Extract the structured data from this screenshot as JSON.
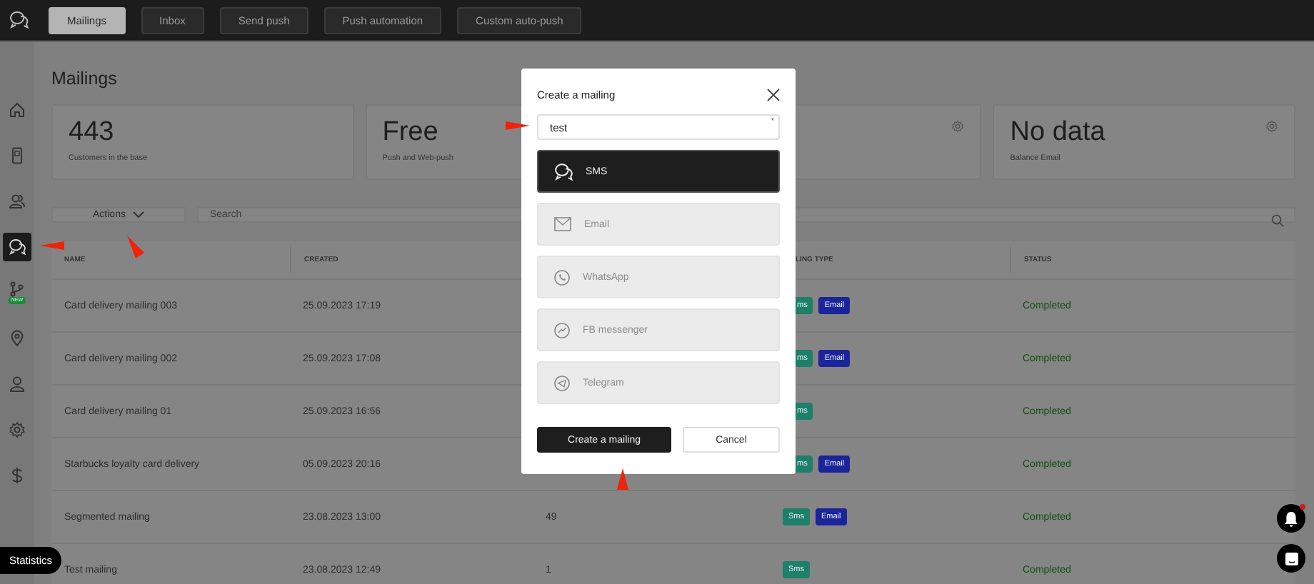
{
  "topbar": {
    "tabs": [
      {
        "label": "Mailings",
        "selected": true
      },
      {
        "label": "Inbox",
        "selected": false
      },
      {
        "label": "Send push",
        "selected": false
      },
      {
        "label": "Push automation",
        "selected": false
      },
      {
        "label": "Custom auto-push",
        "selected": false
      }
    ]
  },
  "sidebar": {
    "items": [
      {
        "kind": "home",
        "selected": false
      },
      {
        "kind": "device",
        "selected": false
      },
      {
        "kind": "users",
        "selected": false
      },
      {
        "kind": "chat",
        "selected": true
      },
      {
        "kind": "branch",
        "selected": false,
        "badge": "NEW"
      },
      {
        "kind": "pin",
        "selected": false
      },
      {
        "kind": "person",
        "selected": false
      },
      {
        "kind": "gear",
        "selected": false
      },
      {
        "kind": "dollar",
        "selected": false
      }
    ]
  },
  "page_title": "Mailings",
  "stats": [
    {
      "value": "443",
      "label": "Customers in the base",
      "settings": false
    },
    {
      "value": "Free",
      "label": "Push and Web-push",
      "settings": false
    },
    {
      "settings": true
    },
    {
      "value": "No data",
      "label": "Balance Email",
      "settings": true
    }
  ],
  "actions": {
    "label": "Actions"
  },
  "search": {
    "placeholder": "Search"
  },
  "table": {
    "headers": {
      "name": "NAME",
      "created": "CREATED",
      "type": "LING TYPE",
      "status": "STATUS"
    },
    "rows": [
      {
        "name": "Card delivery mailing 003",
        "created": "25.09.2023 17:19",
        "tags": [
          {
            "kind": "sms",
            "text": "ms",
            "cut": true
          },
          {
            "kind": "email",
            "text": "Email",
            "cut": false
          }
        ],
        "status": "Completed"
      },
      {
        "name": "Card delivery mailing 002",
        "created": "25.09.2023 17:08",
        "tags": [
          {
            "kind": "sms",
            "text": "ms",
            "cut": true
          },
          {
            "kind": "email",
            "text": "Email",
            "cut": false
          }
        ],
        "status": "Completed"
      },
      {
        "name": "Card delivery mailing 01",
        "created": "25.09.2023 16:56",
        "tags": [
          {
            "kind": "sms",
            "text": "ms",
            "cut": true
          }
        ],
        "status": "Completed"
      },
      {
        "name": "Starbucks loyalty card delivery",
        "created": "05.09.2023 20:16",
        "tags": [
          {
            "kind": "sms",
            "text": "ms",
            "cut": true
          },
          {
            "kind": "email",
            "text": "Email",
            "cut": false
          }
        ],
        "status": "Completed"
      },
      {
        "name": "Segmented mailing",
        "created": "23.08.2023 13:00",
        "count": "49",
        "tags": [
          {
            "kind": "sms",
            "text": "Sms",
            "cut": false
          },
          {
            "kind": "email",
            "text": "Email",
            "cut": false
          }
        ],
        "status": "Completed"
      },
      {
        "name": "Test mailing",
        "created": "23.08.2023 12:49",
        "count": "1",
        "tags": [
          {
            "kind": "sms",
            "text": "Sms",
            "cut": false
          }
        ],
        "status": "Completed"
      }
    ]
  },
  "modal": {
    "title": "Create a mailing",
    "name_field": {
      "value": "test",
      "required_mark": "*"
    },
    "channels": [
      {
        "kind": "sms",
        "label": "SMS",
        "selected": true,
        "disabled": false
      },
      {
        "kind": "email",
        "label": "Email",
        "selected": false,
        "disabled": true
      },
      {
        "kind": "whatsapp",
        "label": "WhatsApp",
        "selected": false,
        "disabled": true
      },
      {
        "kind": "messenger",
        "label": "FB messenger",
        "selected": false,
        "disabled": true
      },
      {
        "kind": "telegram",
        "label": "Telegram",
        "selected": false,
        "disabled": true
      }
    ],
    "buttons": [
      {
        "kind": "primary",
        "label": "Create a mailing"
      },
      {
        "kind": "secondary",
        "label": "Cancel"
      }
    ]
  },
  "statistics_button": "Statistics",
  "notifications": {
    "unread": true
  }
}
